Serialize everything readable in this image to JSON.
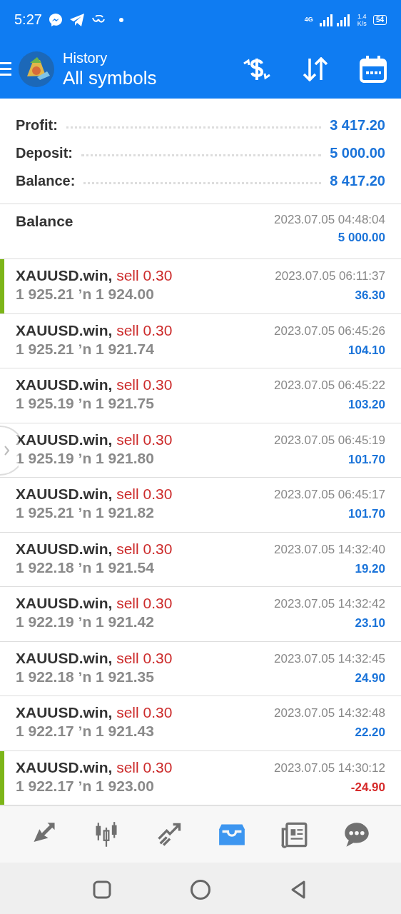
{
  "status_bar": {
    "time": "5:27",
    "network": "4G",
    "speed": "1.4",
    "speed_unit": "K/s",
    "battery": "54"
  },
  "header": {
    "title": "History",
    "subtitle": "All symbols"
  },
  "summary": [
    {
      "label": "Profit:",
      "value": "3 417.20"
    },
    {
      "label": "Deposit:",
      "value": "5 000.00"
    },
    {
      "label": "Balance:",
      "value": "8 417.20"
    }
  ],
  "balance_entry": {
    "label": "Balance",
    "time": "2023.07.05 04:48:04",
    "amount": "5 000.00"
  },
  "deals": [
    {
      "symbol": "XAUUSD.win,",
      "side": "sell 0.30",
      "open": "1 925.21",
      "arrow": "ʼn",
      "close": "1 924.00",
      "time": "2023.07.05 06:11:37",
      "profit": "36.30",
      "negative": false,
      "marked": true
    },
    {
      "symbol": "XAUUSD.win,",
      "side": "sell 0.30",
      "open": "1 925.21",
      "arrow": "ʼn",
      "close": "1 921.74",
      "time": "2023.07.05 06:45:26",
      "profit": "104.10",
      "negative": false,
      "marked": false
    },
    {
      "symbol": "XAUUSD.win,",
      "side": "sell 0.30",
      "open": "1 925.19",
      "arrow": "ʼn",
      "close": "1 921.75",
      "time": "2023.07.05 06:45:22",
      "profit": "103.20",
      "negative": false,
      "marked": false
    },
    {
      "symbol": "XAUUSD.win,",
      "side": "sell 0.30",
      "open": "1 925.19",
      "arrow": "ʼn",
      "close": "1 921.80",
      "time": "2023.07.05 06:45:19",
      "profit": "101.70",
      "negative": false,
      "marked": false
    },
    {
      "symbol": "XAUUSD.win,",
      "side": "sell 0.30",
      "open": "1 925.21",
      "arrow": "ʼn",
      "close": "1 921.82",
      "time": "2023.07.05 06:45:17",
      "profit": "101.70",
      "negative": false,
      "marked": false
    },
    {
      "symbol": "XAUUSD.win,",
      "side": "sell 0.30",
      "open": "1 922.18",
      "arrow": "ʼn",
      "close": "1 921.54",
      "time": "2023.07.05 14:32:40",
      "profit": "19.20",
      "negative": false,
      "marked": false
    },
    {
      "symbol": "XAUUSD.win,",
      "side": "sell 0.30",
      "open": "1 922.19",
      "arrow": "ʼn",
      "close": "1 921.42",
      "time": "2023.07.05 14:32:42",
      "profit": "23.10",
      "negative": false,
      "marked": false
    },
    {
      "symbol": "XAUUSD.win,",
      "side": "sell 0.30",
      "open": "1 922.18",
      "arrow": "ʼn",
      "close": "1 921.35",
      "time": "2023.07.05 14:32:45",
      "profit": "24.90",
      "negative": false,
      "marked": false
    },
    {
      "symbol": "XAUUSD.win,",
      "side": "sell 0.30",
      "open": "1 922.17",
      "arrow": "ʼn",
      "close": "1 921.43",
      "time": "2023.07.05 14:32:48",
      "profit": "22.20",
      "negative": false,
      "marked": false
    },
    {
      "symbol": "XAUUSD.win,",
      "side": "sell 0.30",
      "open": "1 922.17",
      "arrow": "ʼn",
      "close": "1 923.00",
      "time": "2023.07.05 14:30:12",
      "profit": "-24.90",
      "negative": true,
      "marked": true
    }
  ],
  "bottom_nav": [
    {
      "kind": "quotes",
      "selected": false
    },
    {
      "kind": "chart",
      "selected": false
    },
    {
      "kind": "trade",
      "selected": false
    },
    {
      "kind": "history",
      "selected": true
    },
    {
      "kind": "news",
      "selected": false
    },
    {
      "kind": "chat",
      "selected": false
    }
  ]
}
